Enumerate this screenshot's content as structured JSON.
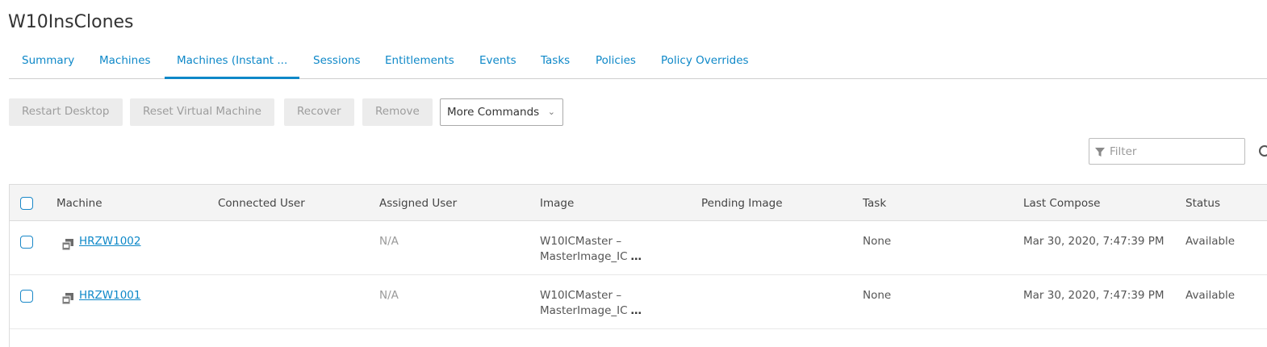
{
  "page_title": "W10InsClones",
  "tabs": [
    {
      "label": "Summary"
    },
    {
      "label": "Machines"
    },
    {
      "label": "Machines (Instant ..."
    },
    {
      "label": "Sessions"
    },
    {
      "label": "Entitlements"
    },
    {
      "label": "Events"
    },
    {
      "label": "Tasks"
    },
    {
      "label": "Policies"
    },
    {
      "label": "Policy Overrides"
    }
  ],
  "active_tab": "Machines (Instant ...",
  "toolbar": {
    "restart_desktop": "Restart Desktop",
    "reset_vm": "Reset Virtual Machine",
    "recover": "Recover",
    "remove": "Remove",
    "more_commands": "More Commands"
  },
  "filter": {
    "placeholder": "Filter",
    "value": ""
  },
  "table": {
    "columns": [
      "Machine",
      "Connected User",
      "Assigned User",
      "Image",
      "Pending Image",
      "Task",
      "Last Compose",
      "Status"
    ],
    "rows": [
      {
        "machine": "HRZW1002",
        "connected_user": "",
        "assigned_user": "N/A",
        "image_line1": "W10ICMaster –",
        "image_line2": "MasterImage_IC",
        "pending_image": "",
        "task": "None",
        "last_compose": "Mar 30, 2020, 7:47:39 PM",
        "status": "Available"
      },
      {
        "machine": "HRZW1001",
        "connected_user": "",
        "assigned_user": "N/A",
        "image_line1": "W10ICMaster –",
        "image_line2": "MasterImage_IC",
        "pending_image": "",
        "task": "None",
        "last_compose": "Mar 30, 2020, 7:47:39 PM",
        "status": "Available"
      }
    ]
  },
  "ellipsis": "…",
  "colors": {
    "accent": "#0e88c8",
    "disabled_btn_bg": "#ececec",
    "header_bg": "#f4f4f4"
  },
  "icons": {
    "filter": "funnel-icon",
    "refresh": "refresh-icon",
    "machine": "virtual-machine-icon",
    "dropdown": "chevron-down-icon"
  }
}
